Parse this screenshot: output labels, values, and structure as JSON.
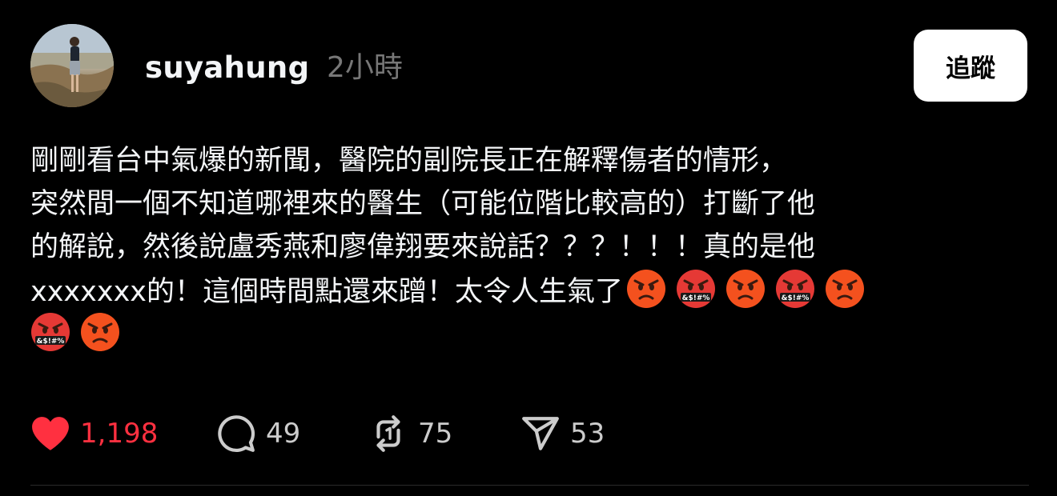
{
  "post": {
    "username": "suyahung",
    "timestamp": "2小時",
    "follow_label": "追蹤",
    "text_lines": [
      "剛剛看台中氣爆的新聞，醫院的副院長正在解釋傷者的情形，",
      "突然間一個不知道哪裡來的醫生（可能位階比較高的）打斷了他",
      "的解說，然後說盧秀燕和廖偉翔要來說話？？？！！！真的是他",
      "xxxxxxx的！這個時間點還來蹭！太令人生氣了"
    ],
    "emojis": [
      "angry-face",
      "cursing-face",
      "angry-face",
      "cursing-face",
      "angry-face",
      "cursing-face",
      "angry-face"
    ],
    "cursing_symbol_text": "&$!#%",
    "actions": {
      "likes": "1,198",
      "comments": "49",
      "reposts": "75",
      "shares": "53"
    },
    "colors": {
      "background": "#000000",
      "text": "#f3f5f7",
      "muted": "#777777",
      "like_red": "#ff3040",
      "angry_emoji": "#f4511e",
      "cursing_emoji": "#e53935"
    }
  }
}
